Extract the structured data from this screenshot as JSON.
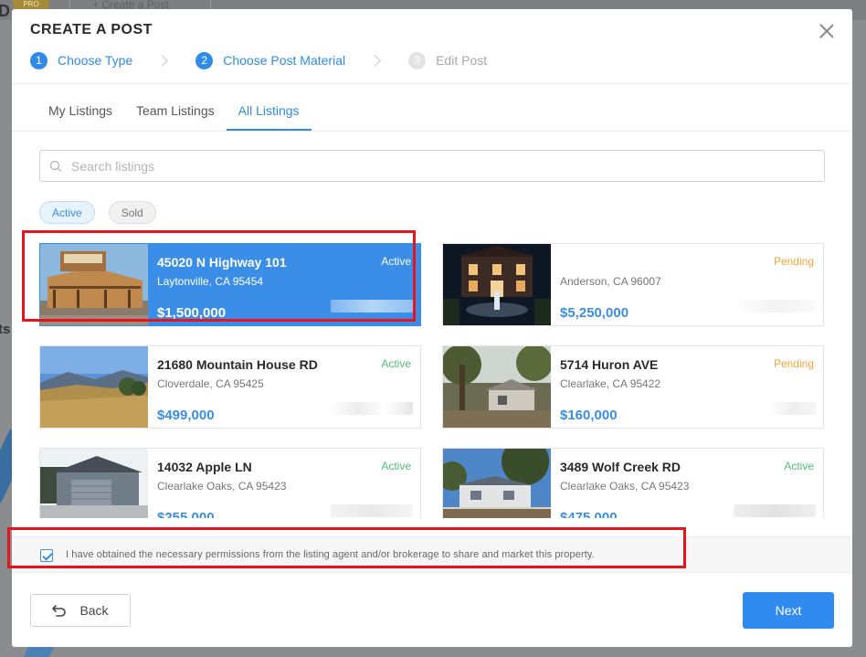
{
  "background": {
    "pro_badge": "PRO",
    "create_post_label": "+ Create a Post"
  },
  "modal": {
    "title": "CREATE A POST",
    "steps": [
      {
        "num": "1",
        "label": "Choose Type",
        "state": "active"
      },
      {
        "num": "2",
        "label": "Choose Post Material",
        "state": "active"
      },
      {
        "num": "3",
        "label": "Edit Post",
        "state": "inactive"
      }
    ],
    "tabs": [
      {
        "label": "My Listings",
        "active": false
      },
      {
        "label": "Team Listings",
        "active": false
      },
      {
        "label": "All Listings",
        "active": true
      }
    ],
    "search": {
      "placeholder": "Search listings",
      "value": ""
    },
    "filters": [
      {
        "label": "Active",
        "selected": true
      },
      {
        "label": "Sold",
        "selected": false
      }
    ],
    "listings": [
      {
        "address": "45020 N Highway 101",
        "city": "Laytonville, CA 95454",
        "price": "$1,500,000",
        "status": "Active",
        "selected": true,
        "photo_icon": "motel-building-photo"
      },
      {
        "address": "",
        "city": "Anderson, CA 96007",
        "price": "$5,250,000",
        "status": "Pending",
        "selected": false,
        "photo_icon": "night-mansion-fountain-photo"
      },
      {
        "address": "21680 Mountain House RD",
        "city": "Cloverdale, CA 95425",
        "price": "$499,000",
        "status": "Active",
        "selected": false,
        "photo_icon": "hillside-meadow-photo"
      },
      {
        "address": "5714 Huron AVE",
        "city": "Clearlake, CA 95422",
        "price": "$160,000",
        "status": "Pending",
        "selected": false,
        "photo_icon": "trees-cabin-photo"
      },
      {
        "address": "14032 Apple LN",
        "city": "Clearlake Oaks, CA 95423",
        "price": "$255,000",
        "status": "Active",
        "selected": false,
        "photo_icon": "house-garage-photo"
      },
      {
        "address": "3489 Wolf Creek RD",
        "city": "Clearlake Oaks, CA 95423",
        "price": "$475,000",
        "status": "Active",
        "selected": false,
        "photo_icon": "fenced-house-photo"
      }
    ],
    "consent": {
      "checked": true,
      "text": "I have obtained the necessary permissions from the listing agent and/or brokerage to share and market this property."
    },
    "buttons": {
      "back": "Back",
      "next": "Next"
    },
    "colors": {
      "primary": "#2f8be6",
      "active_status": "#4fbf7a",
      "pending_status": "#f0a43a",
      "highlight": "#e8141b"
    }
  }
}
